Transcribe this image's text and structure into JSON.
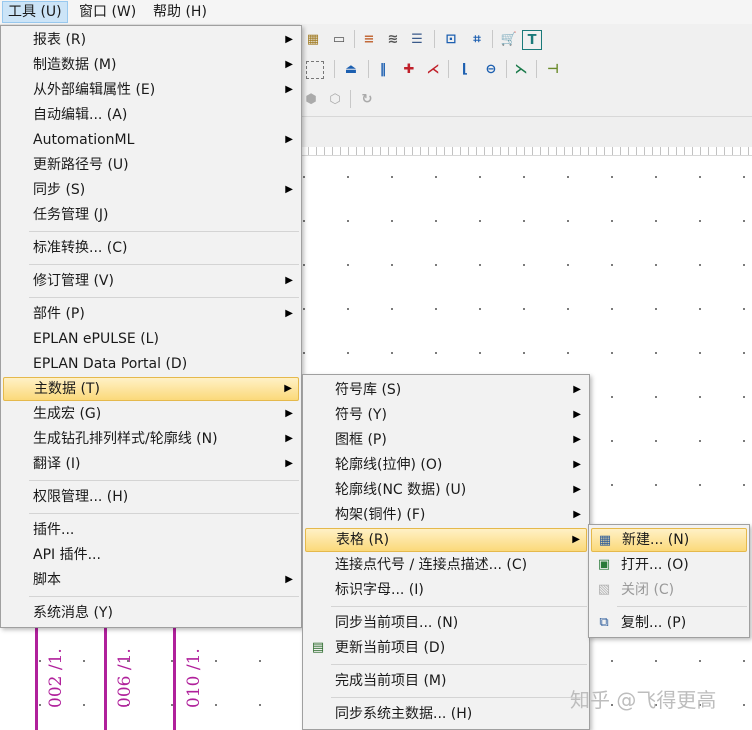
{
  "menubar": {
    "tools": "工具 (U)",
    "window": "窗口 (W)",
    "help": "帮助 (H)"
  },
  "tools_menu": {
    "report": "报表 (R)",
    "manufacturing_data": "制造数据 (M)",
    "external_edit": "从外部编辑属性 (E)",
    "auto_edit": "自动编辑... (A)",
    "automationml": "AutomationML",
    "update_path": "更新路径号 (U)",
    "sync": "同步 (S)",
    "task_mgmt": "任务管理 (J)",
    "std_convert": "标准转换... (C)",
    "revision_mgmt": "修订管理 (V)",
    "parts": "部件 (P)",
    "epulse": "EPLAN ePULSE (L)",
    "data_portal": "EPLAN Data Portal (D)",
    "master_data": "主数据 (T)",
    "gen_macro": "生成宏 (G)",
    "drill_pattern": "生成钻孔排列样式/轮廓线 (N)",
    "translate": "翻译 (I)",
    "rights_mgmt": "权限管理... (H)",
    "plugins": "插件...",
    "api_plugins": "API 插件...",
    "script": "脚本",
    "system_msg": "系统消息 (Y)"
  },
  "master_data_menu": {
    "symbol_lib": "符号库 (S)",
    "symbol": "符号 (Y)",
    "frame": "图框 (P)",
    "outline_stretch": "轮廓线(拉伸) (O)",
    "outline_nc": "轮廓线(NC 数据) (U)",
    "rack": "构架(铜件) (F)",
    "form": "表格 (R)",
    "connection_code": "连接点代号 / 连接点描述... (C)",
    "ident_char": "标识字母... (I)",
    "sync_current": "同步当前项目... (N)",
    "update_current": "更新当前项目 (D)",
    "complete_current": "完成当前项目 (M)",
    "sync_system": "同步系统主数据... (H)"
  },
  "form_menu": {
    "new": "新建... (N)",
    "open": "打开... (O)",
    "close": "关闭 (C)",
    "copy": "复制... (P)"
  },
  "canvas": {
    "label1": "002 /1.",
    "label2": "006 /1.",
    "label3": "010 /1."
  },
  "watermark": "知乎 @飞得更高",
  "colors": {
    "highlight": "#fbd97a",
    "wire": "#b0209b"
  }
}
